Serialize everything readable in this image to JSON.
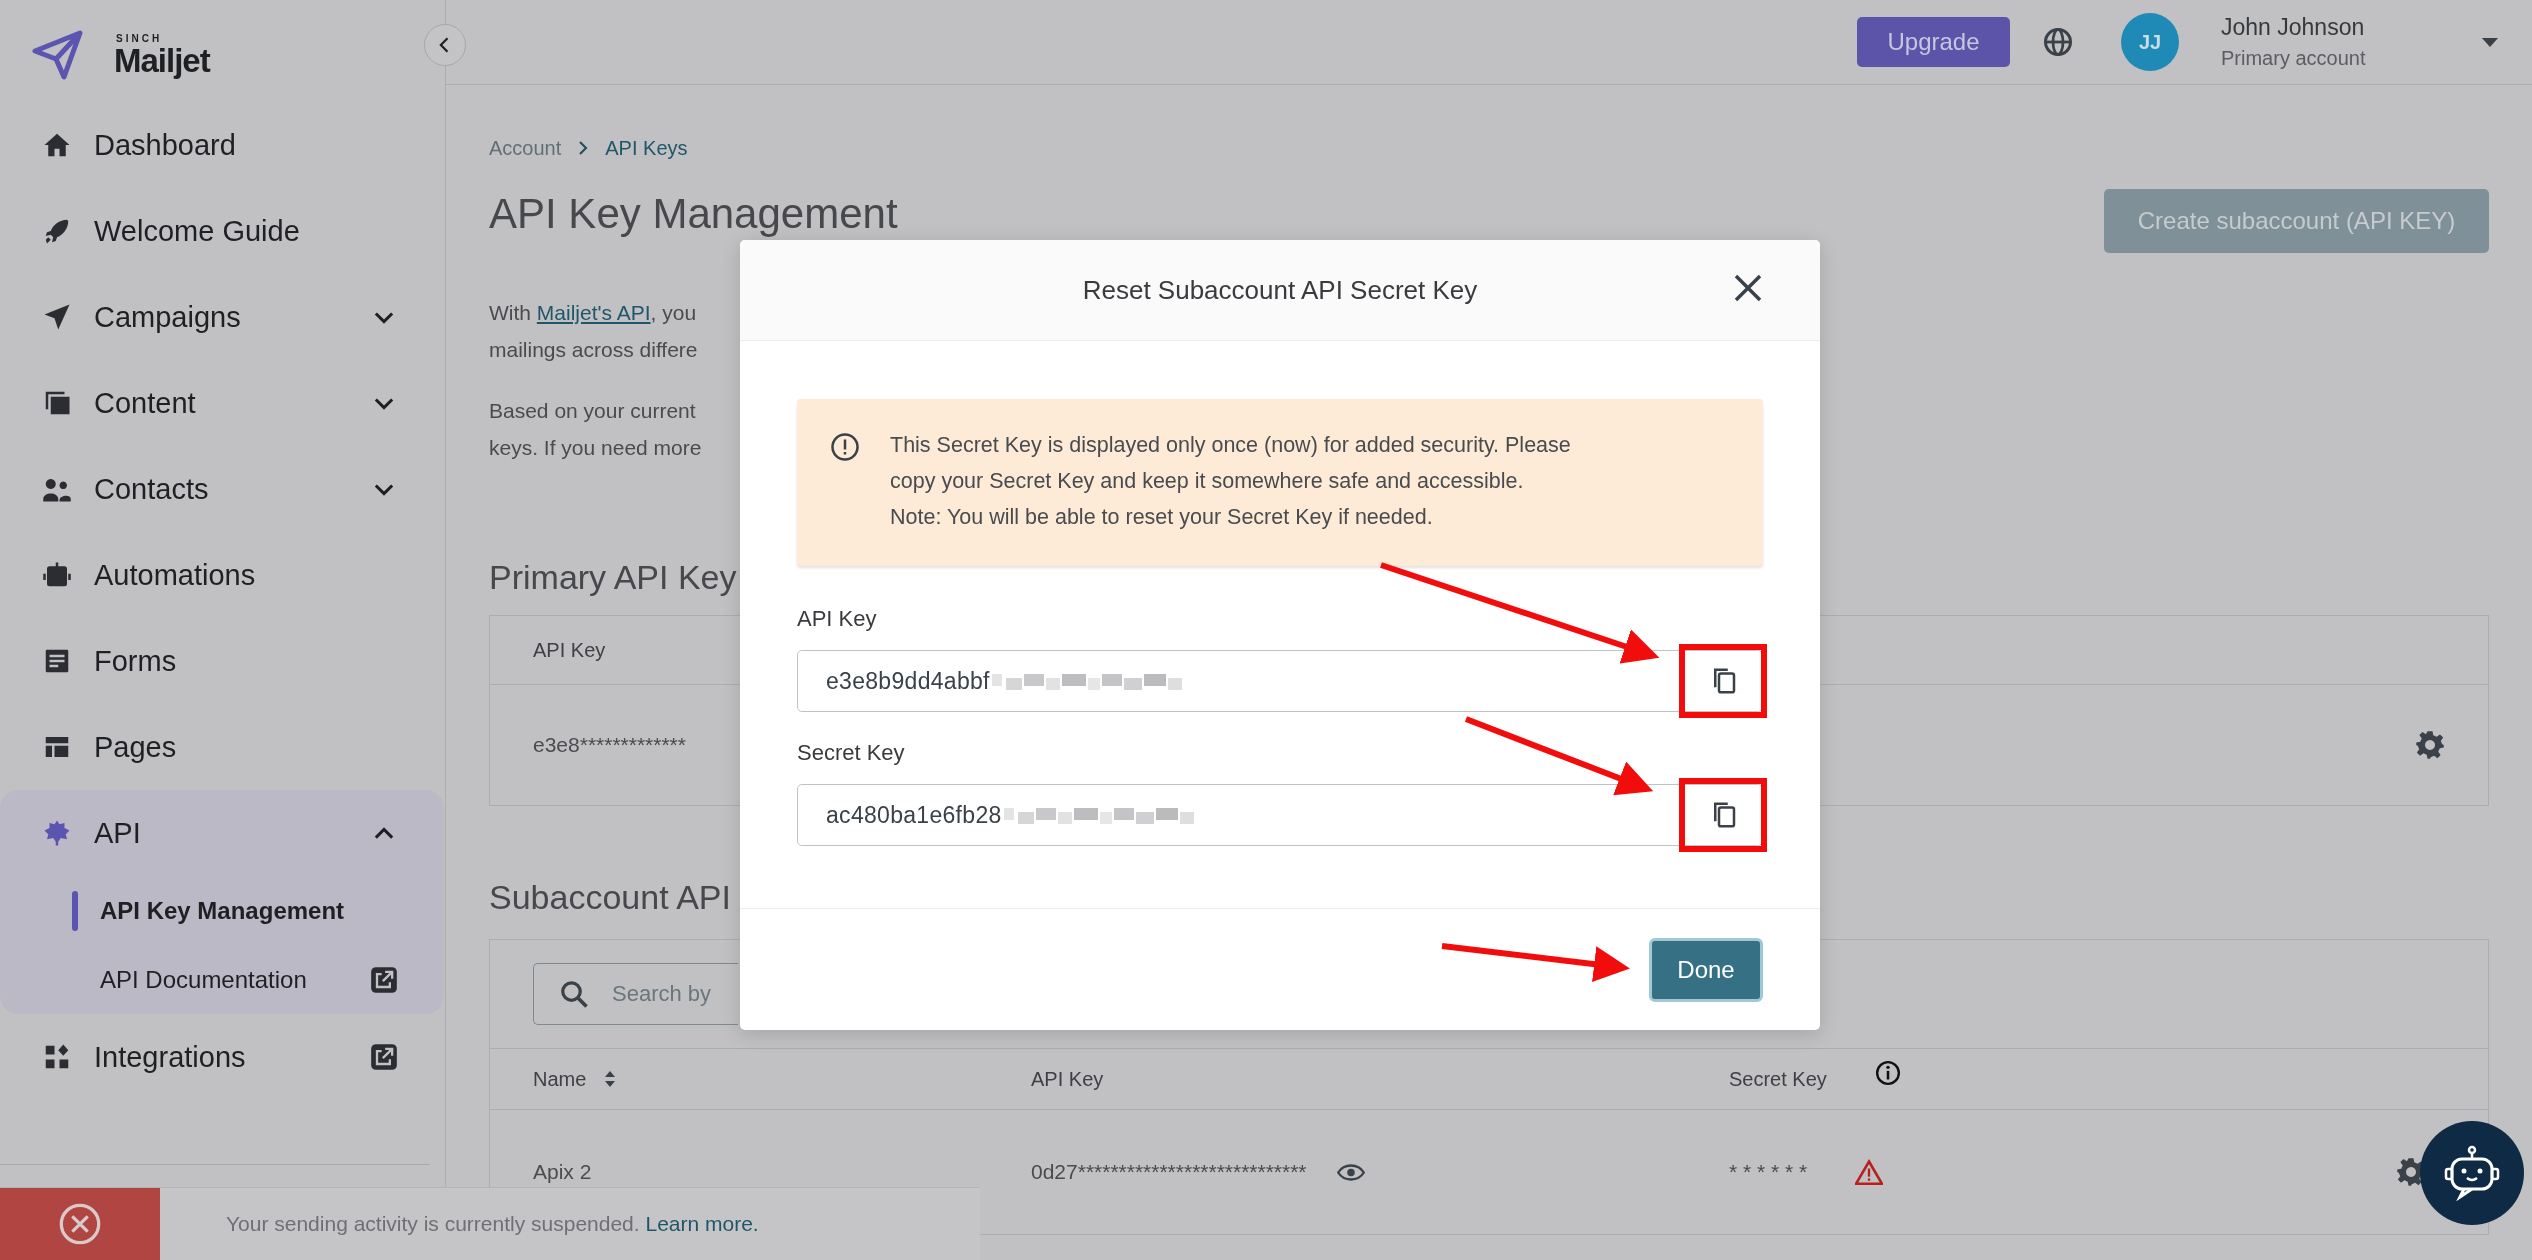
{
  "logo": {
    "brand_top": "SINCH",
    "brand": "Mailjet"
  },
  "topbar": {
    "upgrade_button": "Upgrade",
    "avatar_initials": "JJ",
    "user_name": "John Johnson",
    "account_type": "Primary account"
  },
  "sidebar": {
    "items": [
      {
        "label": "Dashboard",
        "selected": false
      },
      {
        "label": "Welcome Guide",
        "selected": false
      },
      {
        "label": "Campaigns",
        "selected": false,
        "expanded": false
      },
      {
        "label": "Content",
        "selected": false,
        "expanded": false
      },
      {
        "label": "Contacts",
        "selected": false,
        "expanded": false
      },
      {
        "label": "Automations",
        "selected": false
      },
      {
        "label": "Forms",
        "selected": false
      },
      {
        "label": "Pages",
        "selected": false
      },
      {
        "label": "API",
        "selected": true,
        "expanded": true,
        "children": [
          {
            "label": "API Key Management",
            "selected": true,
            "external": false
          },
          {
            "label": "API Documentation",
            "selected": false,
            "external": true
          }
        ]
      },
      {
        "label": "Integrations",
        "selected": false,
        "external": true
      }
    ]
  },
  "breadcrumb": [
    {
      "label": "Account",
      "current": false
    },
    {
      "label": "API Keys",
      "current": true
    }
  ],
  "page_title": "API Key Management",
  "create_button": "Create subaccount (API KEY)",
  "intro": [
    {
      "link_prefix": "With ",
      "link": "Mailjet's API",
      "text": ", you\nmailings across differe"
    },
    {
      "text": "Based on your current\nkeys. If you need more"
    }
  ],
  "primary_section": {
    "heading": "Primary API Key",
    "column": "API Key",
    "cell": "e3e8*************"
  },
  "subaccount_section": {
    "heading": "Subaccount API",
    "search": {
      "placeholder": "Search by"
    },
    "columns": [
      {
        "label": "Name",
        "sortable": true
      },
      {
        "label": "API Key"
      },
      {
        "label": "Secret Key",
        "info": true
      }
    ],
    "rows": [
      {
        "name": "Apix 2",
        "api_key": "0d27****************************",
        "secret": "* * * * * *",
        "warning": true
      }
    ]
  },
  "modal": {
    "title": "Reset Subaccount API Secret Key",
    "notice": "This Secret Key is displayed only once (now) for added security. Please\ncopy your Secret Key and keep it somewhere safe and accessible.\nNote: You will be able to reset your Secret Key if needed.",
    "fields": [
      {
        "label": "API Key",
        "value": "e3e8b9dd4abbf"
      },
      {
        "label": "Secret Key",
        "value": "ac480ba1e6fb28"
      }
    ],
    "done_button": "Done"
  },
  "banner": {
    "message": "Your sending activity is currently suspended.",
    "link": "Learn more."
  }
}
